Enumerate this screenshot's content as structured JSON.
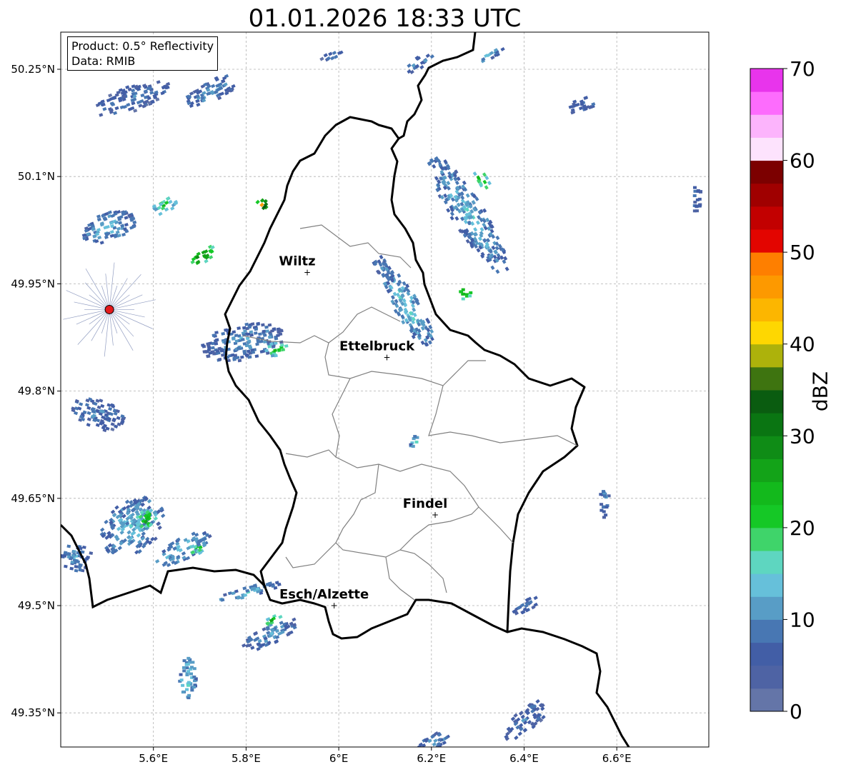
{
  "title": "01.01.2026 18:33 UTC",
  "info": {
    "product": "Product: 0.5° Reflectivity",
    "data": "Data: RMIB"
  },
  "map": {
    "lon_range": [
      5.4,
      6.8
    ],
    "lat_range": [
      49.3,
      50.3
    ],
    "lat_ticks": [
      {
        "value": 50.25,
        "label": "50.25°N"
      },
      {
        "value": 50.1,
        "label": "50.1°N"
      },
      {
        "value": 49.95,
        "label": "49.95°N"
      },
      {
        "value": 49.8,
        "label": "49.8°N"
      },
      {
        "value": 49.65,
        "label": "49.65°N"
      },
      {
        "value": 49.5,
        "label": "49.5°N"
      },
      {
        "value": 49.35,
        "label": "49.35°N"
      }
    ],
    "lon_ticks": [
      {
        "value": 5.6,
        "label": "5.6°E"
      },
      {
        "value": 5.8,
        "label": "5.8°E"
      },
      {
        "value": 6.0,
        "label": "6°E"
      },
      {
        "value": 6.2,
        "label": "6.2°E"
      },
      {
        "value": 6.4,
        "label": "6.4°E"
      },
      {
        "value": 6.6,
        "label": "6.6°E"
      }
    ],
    "grid": true,
    "radar_site": {
      "lon": 5.505,
      "lat": 49.914,
      "color": "#e41a1c"
    },
    "cities": [
      {
        "name": "Wiltz",
        "lon": 5.932,
        "lat": 49.966
      },
      {
        "name": "Ettelbruck",
        "lon": 6.104,
        "lat": 49.847
      },
      {
        "name": "Findel",
        "lon": 6.208,
        "lat": 49.627
      },
      {
        "name": "Esch/Alzette",
        "lon": 5.99,
        "lat": 49.5
      }
    ],
    "reflectivity_cells": [
      {
        "lon": 5.55,
        "lat": 50.21,
        "dlon": 0.17,
        "dlat": 0.035,
        "dbz": 8,
        "angle": -20
      },
      {
        "lon": 5.72,
        "lat": 50.22,
        "dlon": 0.12,
        "dlat": 0.03,
        "dbz": 10,
        "angle": -25
      },
      {
        "lon": 5.98,
        "lat": 50.27,
        "dlon": 0.05,
        "dlat": 0.012,
        "dbz": 8,
        "angle": -30
      },
      {
        "lon": 6.17,
        "lat": 50.26,
        "dlon": 0.07,
        "dlat": 0.015,
        "dbz": 10,
        "angle": -35
      },
      {
        "lon": 6.32,
        "lat": 50.27,
        "dlon": 0.07,
        "dlat": 0.012,
        "dbz": 12,
        "angle": -30
      },
      {
        "lon": 6.28,
        "lat": 50.05,
        "dlon": 0.3,
        "dlat": 0.045,
        "dbz": 12,
        "angle": 58
      },
      {
        "lon": 6.31,
        "lat": 50.1,
        "dlon": 0.05,
        "dlat": 0.015,
        "dbz": 25,
        "angle": 58
      },
      {
        "lon": 6.15,
        "lat": 49.92,
        "dlon": 0.2,
        "dlat": 0.035,
        "dbz": 14,
        "angle": 60
      },
      {
        "lon": 6.1,
        "lat": 49.97,
        "dlon": 0.08,
        "dlat": 0.02,
        "dbz": 10,
        "angle": 60
      },
      {
        "lon": 5.79,
        "lat": 49.87,
        "dlon": 0.18,
        "dlat": 0.05,
        "dbz": 10,
        "angle": -10
      },
      {
        "lon": 5.86,
        "lat": 49.86,
        "dlon": 0.05,
        "dlat": 0.018,
        "dbz": 24,
        "angle": -10
      },
      {
        "lon": 5.5,
        "lat": 50.03,
        "dlon": 0.12,
        "dlat": 0.04,
        "dbz": 12,
        "angle": -20
      },
      {
        "lon": 5.62,
        "lat": 50.06,
        "dlon": 0.06,
        "dlat": 0.02,
        "dbz": 20,
        "angle": -30
      },
      {
        "lon": 5.7,
        "lat": 49.99,
        "dlon": 0.06,
        "dlat": 0.02,
        "dbz": 30,
        "angle": -30
      },
      {
        "lon": 5.83,
        "lat": 50.06,
        "dlon": 0.03,
        "dlat": 0.015,
        "dbz": 40,
        "angle": -45
      },
      {
        "lon": 5.48,
        "lat": 49.77,
        "dlon": 0.12,
        "dlat": 0.04,
        "dbz": 8,
        "angle": 20
      },
      {
        "lon": 5.55,
        "lat": 49.61,
        "dlon": 0.15,
        "dlat": 0.07,
        "dbz": 12,
        "angle": -40
      },
      {
        "lon": 5.58,
        "lat": 49.62,
        "dlon": 0.05,
        "dlat": 0.025,
        "dbz": 24,
        "angle": -40
      },
      {
        "lon": 5.66,
        "lat": 49.58,
        "dlon": 0.13,
        "dlat": 0.03,
        "dbz": 14,
        "angle": -30
      },
      {
        "lon": 5.69,
        "lat": 49.58,
        "dlon": 0.04,
        "dlat": 0.015,
        "dbz": 22,
        "angle": -30
      },
      {
        "lon": 5.43,
        "lat": 49.57,
        "dlon": 0.07,
        "dlat": 0.04,
        "dbz": 10,
        "angle": 10
      },
      {
        "lon": 5.85,
        "lat": 49.46,
        "dlon": 0.14,
        "dlat": 0.025,
        "dbz": 10,
        "angle": -25
      },
      {
        "lon": 5.67,
        "lat": 49.4,
        "dlon": 0.04,
        "dlat": 0.06,
        "dbz": 14,
        "angle": 0
      },
      {
        "lon": 5.8,
        "lat": 49.52,
        "dlon": 0.15,
        "dlat": 0.015,
        "dbz": 12,
        "angle": -15
      },
      {
        "lon": 6.4,
        "lat": 49.34,
        "dlon": 0.12,
        "dlat": 0.03,
        "dbz": 8,
        "angle": -40
      },
      {
        "lon": 6.2,
        "lat": 49.31,
        "dlon": 0.08,
        "dlat": 0.02,
        "dbz": 10,
        "angle": -30
      },
      {
        "lon": 6.52,
        "lat": 50.2,
        "dlon": 0.06,
        "dlat": 0.02,
        "dbz": 8,
        "angle": -20
      },
      {
        "lon": 6.77,
        "lat": 50.07,
        "dlon": 0.02,
        "dlat": 0.04,
        "dbz": 8,
        "angle": 0
      },
      {
        "lon": 6.27,
        "lat": 49.94,
        "dlon": 0.03,
        "dlat": 0.02,
        "dbz": 28,
        "angle": 0
      },
      {
        "lon": 6.57,
        "lat": 49.65,
        "dlon": 0.02,
        "dlat": 0.05,
        "dbz": 10,
        "angle": 0
      },
      {
        "lon": 6.4,
        "lat": 49.5,
        "dlon": 0.06,
        "dlat": 0.02,
        "dbz": 8,
        "angle": -30
      },
      {
        "lon": 6.16,
        "lat": 49.73,
        "dlon": 0.02,
        "dlat": 0.02,
        "dbz": 16,
        "angle": 0
      },
      {
        "lon": 5.85,
        "lat": 49.48,
        "dlon": 0.05,
        "dlat": 0.012,
        "dbz": 22,
        "angle": -25
      }
    ]
  },
  "colorbar": {
    "label": "dBZ",
    "min": 0,
    "max": 70,
    "step": 2.5,
    "ticks": [
      {
        "value": 0,
        "label": "0"
      },
      {
        "value": 10,
        "label": "10"
      },
      {
        "value": 20,
        "label": "20"
      },
      {
        "value": 30,
        "label": "30"
      },
      {
        "value": 40,
        "label": "40"
      },
      {
        "value": 50,
        "label": "50"
      },
      {
        "value": 60,
        "label": "60"
      },
      {
        "value": 70,
        "label": "70"
      }
    ],
    "colors": [
      "#6475a8",
      "#4e63a4",
      "#425ea6",
      "#4877b3",
      "#589dc6",
      "#66c0da",
      "#5ed6c0",
      "#3fd46a",
      "#15c826",
      "#13b91c",
      "#13a318",
      "#0f8c16",
      "#0a7512",
      "#0a5c10",
      "#3e7410",
      "#adb20b",
      "#fed701",
      "#fcb600",
      "#fd9900",
      "#fe7f00",
      "#e30500",
      "#c20000",
      "#a00000",
      "#7c0000",
      "#fde3fd",
      "#fcb4fc",
      "#fd6cfd",
      "#e834ec"
    ]
  }
}
